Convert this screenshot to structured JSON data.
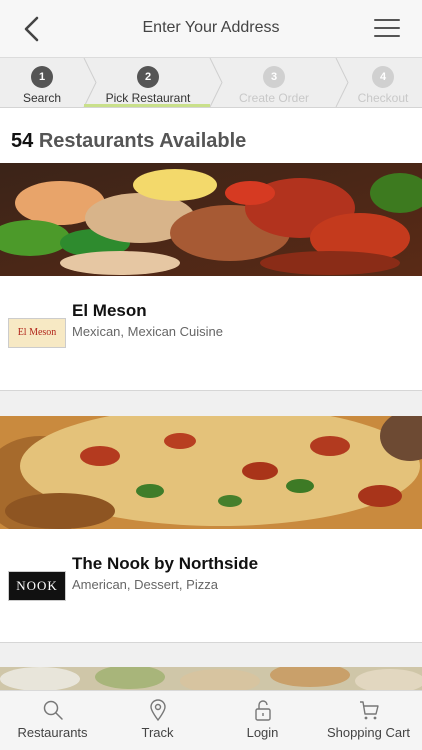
{
  "header": {
    "title": "Enter Your Address",
    "back_icon": "chevron-left-icon",
    "menu_icon": "hamburger-menu-icon"
  },
  "steps": [
    {
      "number": "1",
      "label": "Search",
      "state": "done"
    },
    {
      "number": "2",
      "label": "Pick Restaurant",
      "state": "active"
    },
    {
      "number": "3",
      "label": "Create Order",
      "state": "inactive"
    },
    {
      "number": "4",
      "label": "Checkout",
      "state": "inactive"
    }
  ],
  "results": {
    "count": "54",
    "label": "Restaurants Available"
  },
  "restaurants": [
    {
      "name": "El Meson",
      "cuisines": "Mexican, Mexican Cuisine",
      "logo_text": "El Meson",
      "image": "fajitas-photo"
    },
    {
      "name": "The Nook by Northside",
      "cuisines": "American, Dessert, Pizza",
      "logo_text": "NOOK",
      "image": "pizza-photo"
    }
  ],
  "tabbar": [
    {
      "label": "Restaurants",
      "icon": "search-icon"
    },
    {
      "label": "Track",
      "icon": "map-pin-icon"
    },
    {
      "label": "Login",
      "icon": "lock-icon"
    },
    {
      "label": "Shopping Cart",
      "icon": "cart-icon"
    }
  ],
  "colors": {
    "accent_underline": "#c9e08a",
    "active_step": "#555555",
    "inactive_step": "#d0d0d0"
  }
}
